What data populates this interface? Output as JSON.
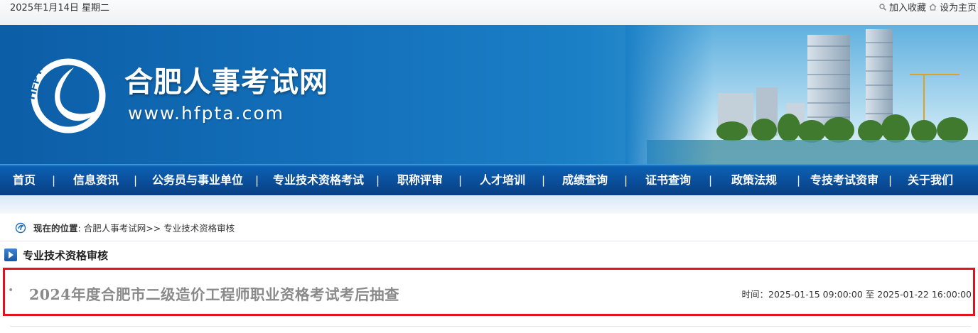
{
  "topbar": {
    "date": "2025年1月14日 星期二",
    "add_favorite": "加入收藏",
    "set_homepage": "设为主页",
    "icons": [
      "search-icon",
      "home-icon"
    ]
  },
  "banner": {
    "logo_text": "HFPTA",
    "site_name": "合肥人事考试网",
    "site_url": "www.hfpta.com"
  },
  "nav": {
    "items": [
      "首页",
      "信息资讯",
      "公务员与事业单位",
      "专业技术资格考试",
      "职称评审",
      "人才培训",
      "成绩查询",
      "证书查询",
      "政策法规",
      "专技考试资审",
      "关于我们"
    ],
    "separator": "|"
  },
  "breadcrumb": {
    "label": "现在的位置",
    "colon": ": ",
    "home": "合肥人事考试网",
    "arrow": ">> ",
    "current": "专业技术资格审核"
  },
  "section": {
    "title": "专业技术资格审核"
  },
  "item": {
    "bullet": "•",
    "title": "2024年度合肥市二级造价工程师职业资格考试考后抽查",
    "time_label": "时间：",
    "time_value": "2025-01-15 09:00:00 至 2025-01-22 16:00:00"
  },
  "colors": {
    "nav_bg": "#0a4e9a",
    "highlight_border": "#e0141e",
    "item_title": "#8a8a8a"
  }
}
